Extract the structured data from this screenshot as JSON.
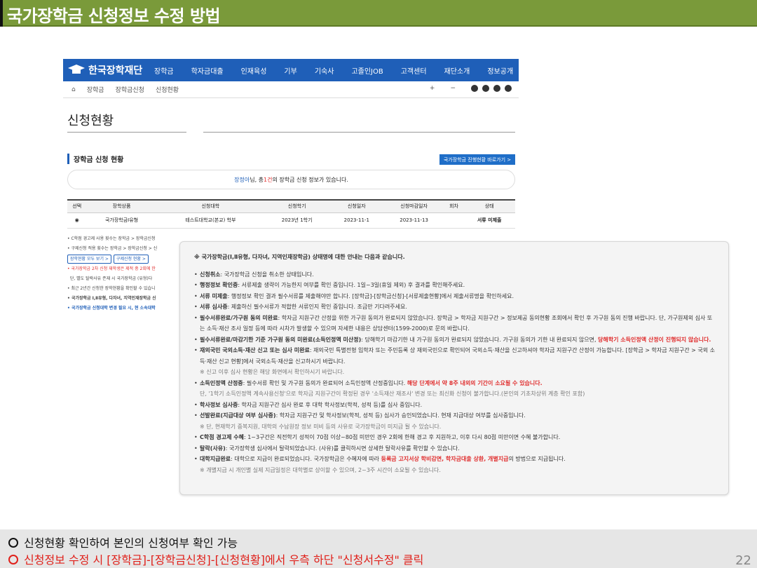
{
  "slide_title": "국가장학금 신청정보 수정 방법",
  "site": {
    "logo_text": "한국장학재단",
    "menu": [
      "장학금",
      "학자금대출",
      "인재육성",
      "기부",
      "기숙사",
      "고졸인JOB",
      "고객센터",
      "재단소개",
      "정보공개"
    ],
    "breadcrumb": [
      "장학금",
      "장학금신청",
      "신청현황"
    ],
    "page_title": "신청현황",
    "section_title": "장학금 신청 현황",
    "go_button": "국가장학금 진행현황 바로가기 >",
    "notice_user": "장정아",
    "notice_mid": "님, 총 ",
    "notice_count": "1건",
    "notice_tail": "의 장학금 신청 정보가 있습니다.",
    "table": {
      "headers": [
        "선택",
        "장학상품",
        "신청대학",
        "신청학기",
        "신청일자",
        "신청마감일자",
        "회차",
        "상태"
      ],
      "row": [
        "◉",
        "국가장학금Ⅰ유형",
        "테스트대학교(본교) 학부",
        "2023년 1학기",
        "2023-11-1",
        "2023-11-13",
        "",
        "서류 미제출"
      ]
    },
    "left_notes": [
      "C학점 경고제 사용 횟수는 장학금 > 장학금신청",
      "구제신청 적용 횟수는 장학금 > 장학금신청 > 신",
      "국가장학금 2차 신청 재학생은 제적 중 2회에 한",
      "단, 별도 탈락사유 존재 시 국가장학금 (유형)다",
      "최근 2년간 신청한 장학현황을 확인할 수 있습니",
      "국가장학금 Ⅰ,Ⅱ유형, 다자녀, 지역인재장학금 신",
      "국가장학금 신청대학 변경 필요 시, 현 소속대학"
    ],
    "left_buttons": [
      "장학현황 모두 보기 >",
      "구제신청 현황 >"
    ]
  },
  "popup": {
    "heading": "※ 국가장학금(Ⅰ,Ⅱ유형, 다자녀, 지역인재장학금) 상태명에 대한 안내는 다음과 같습니다.",
    "items": [
      {
        "label": "신청취소",
        "text": ": 국가장학금 신청을 취소한 상태입니다."
      },
      {
        "label": "행정정보 확인중",
        "text": ": 서류제출 생략이 가능한지 여부를 확인 중입니다. 1일~3일(휴일 제외) 후 결과를 확인해주세요."
      },
      {
        "label": "서류 미제출",
        "text": ": 행정정보 확인 결과 필수서류를 제출해야만 합니다. [장학금]-[장학금신청]-[서류제출현황]에서 제출서류명을 확인하세요."
      },
      {
        "label": "서류 심사중",
        "text": ": 제출하신 필수서류가 적합한 서류인지 확인 중입니다. 조금만 기다려주세요."
      },
      {
        "label": "필수서류완료/가구원 동의 미완료",
        "text": ": 학자금 지원구간 산정을 위한 가구원 동의가 완료되지 않았습니다. 장학금 > 학자금 지원구간 > 정보제공 동의현황 조회에서 확인 후 가구원 동의 진행 바랍니다. 단, 가구원제외 심사 또는 소득·재산 조사 일정 등에 따라 시차가 발생할 수 있으며 자세한 내용은 상담센터(1599-2000)로 문의 바랍니다."
      },
      {
        "label": "필수서류완료/마감기한 기준 가구원 동의 미완료(소득인정액 미산정)",
        "text": ": 당해학기 마감기한 내 가구원 동의가 완료되지 않았습니다. 가구원 동의가 기한 내 완료되지 않으면, ",
        "red": "당해학기 소득인정액 산정이 진행되지 않습니다."
      },
      {
        "label": "재외국민 국외소득·재산 신고 또는 심사 미완료",
        "text": ": 재외국민 특별전형 입학자 또는 주민등록 상 재외국민으로 확인되어 국외소득·재산을 신고하셔야 학자금 지원구간 산정이 가능합니다. [장학금 > 학자금 지원구간 > 국외 소득·재산 신고 현황]에서 국외소득·재산을 신고하시기 바랍니다.",
        "sub": "※ 신고 이후 심사 현황은 해당 화면에서 확인하시기 바랍니다."
      },
      {
        "label": "소득인정액 산정중",
        "text": ": 필수서류 확인 및 가구원 동의가 완료되어 소득인정액 산정중입니다. ",
        "red": "해당 단계에서 약 8주 내외의 기간이 소요될 수 있습니다.",
        "sub": "단, '1학기 소득인정액 계속사용신청'으로 학자금 지원구간이 확정된 경우 '소득재산 재조사' 변경 또는 최신화 신청이 불가합니다.(본인의 기초차상위 계층 확인 포함)"
      },
      {
        "label": "학사정보 심사중",
        "text": ": 학자금 지원구간 심사 완료 후 대학 학사정보(학적, 성적 등)를 심사 중입니다."
      },
      {
        "label": "선발완료(지급대상 여부 심사중)",
        "text": ": 학자금 지원구간 및 학사정보(학적, 성적 등) 심사가 승인되었습니다. 현재 지급대상 여부를 심사중입니다.",
        "sub": "※ 단, 현재학기 중복지원, 대학의 수납원장 정보 미비 등의 사유로 국가장학금이 미지급 될 수 있습니다."
      },
      {
        "label": "C학점 경고제 수혜",
        "text": ": 1~3구간은 직전학기 성적이 70점 이상~80점 미만인 경우 2회에 한해 경고 후 지원하고, 이후 다시 80점 미만이면 수혜 불가합니다."
      },
      {
        "label": "탈락(사유)",
        "text": ": 국가장학생 심사에서 탈락되었습니다. (사유)를 클릭하시면 상세한 탈락사유를 확인할 수 있습니다."
      },
      {
        "label": "대학지급완료",
        "text": ": 대학으로 지급이 완료되었습니다. 국가장학금은 수혜자에 따라 ",
        "red": "등록금 고지서상 학비감면, 학자금대출 상환, 개별지급",
        "tail": "의 방법으로 지급됩니다.",
        "sub": "※ 개별지급 시 개인별 실제 지급일정은 대학별로 상이할 수 있으며, 2~3주 시간이 소요될 수 있습니다."
      }
    ]
  },
  "bottom": {
    "line1": "신청현황 확인하여 본인의 신청여부 확인 가능",
    "line2": "신청정보 수정 시 [장학금]-[장학금신청]-[신청현황]에서  우측 하단 \"신청서수정\" 클릭",
    "page_number": "22"
  },
  "colors": {
    "title_bar": "#7a9a3a",
    "nav_blue": "#1f5fb8",
    "alert_red": "#e0201a"
  }
}
